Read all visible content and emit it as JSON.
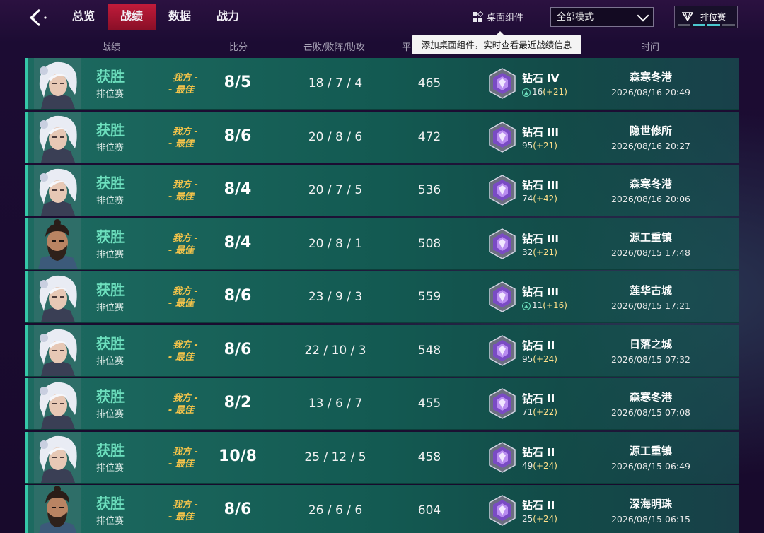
{
  "nav": {
    "tabs": [
      {
        "label": "总览",
        "active": false
      },
      {
        "label": "战绩",
        "active": true
      },
      {
        "label": "数据",
        "active": false
      },
      {
        "label": "战力",
        "active": false
      }
    ]
  },
  "toolbar": {
    "widget_label": "桌面组件",
    "tooltip": "添加桌面组件，实时查看最近战绩信息",
    "mode_select_value": "全部模式",
    "rank_mode_label": "排位赛"
  },
  "columns": {
    "record": "战绩",
    "score": "比分",
    "kda": "击败/败阵/助攻",
    "avg": "平",
    "time": "时间"
  },
  "matches": [
    {
      "hero": "white-hair",
      "result": "获胜",
      "type": "排位赛",
      "mvp1": "我方 -",
      "mvp2": "- 最佳",
      "score": "8/5",
      "kda": "18 / 7 / 4",
      "avg": "465",
      "tier": "钻石 IV",
      "pts": "16",
      "delta": "(+21)",
      "promo": true,
      "map": "森寒冬港",
      "time": "2026/08/16 20:49"
    },
    {
      "hero": "white-hair",
      "result": "获胜",
      "type": "排位赛",
      "mvp1": "我方 -",
      "mvp2": "- 最佳",
      "score": "8/6",
      "kda": "20 / 8 / 6",
      "avg": "472",
      "tier": "钻石 III",
      "pts": "95",
      "delta": "(+21)",
      "promo": false,
      "map": "隐世修所",
      "time": "2026/08/16 20:27"
    },
    {
      "hero": "white-hair",
      "result": "获胜",
      "type": "排位赛",
      "mvp1": "我方 -",
      "mvp2": "- 最佳",
      "score": "8/4",
      "kda": "20 / 7 / 5",
      "avg": "536",
      "tier": "钻石 III",
      "pts": "74",
      "delta": "(+42)",
      "promo": false,
      "map": "森寒冬港",
      "time": "2026/08/16 20:06"
    },
    {
      "hero": "bearded",
      "result": "获胜",
      "type": "排位赛",
      "mvp1": "我方 -",
      "mvp2": "- 最佳",
      "score": "8/4",
      "kda": "20 / 8 / 1",
      "avg": "508",
      "tier": "钻石 III",
      "pts": "32",
      "delta": "(+21)",
      "promo": false,
      "map": "源工重镇",
      "time": "2026/08/15 17:48"
    },
    {
      "hero": "white-hair",
      "result": "获胜",
      "type": "排位赛",
      "mvp1": "我方 -",
      "mvp2": "- 最佳",
      "score": "8/6",
      "kda": "23 / 9 / 3",
      "avg": "559",
      "tier": "钻石 III",
      "pts": "11",
      "delta": "(+16)",
      "promo": true,
      "map": "莲华古城",
      "time": "2026/08/15 17:21"
    },
    {
      "hero": "white-hair",
      "result": "获胜",
      "type": "排位赛",
      "mvp1": "我方 -",
      "mvp2": "- 最佳",
      "score": "8/6",
      "kda": "22 / 10 / 3",
      "avg": "548",
      "tier": "钻石 II",
      "pts": "95",
      "delta": "(+24)",
      "promo": false,
      "map": "日落之城",
      "time": "2026/08/15 07:32"
    },
    {
      "hero": "white-hair",
      "result": "获胜",
      "type": "排位赛",
      "mvp1": "我方 -",
      "mvp2": "- 最佳",
      "score": "8/2",
      "kda": "13 / 6 / 7",
      "avg": "455",
      "tier": "钻石 II",
      "pts": "71",
      "delta": "(+22)",
      "promo": false,
      "map": "森寒冬港",
      "time": "2026/08/15 07:08"
    },
    {
      "hero": "white-hair",
      "result": "获胜",
      "type": "排位赛",
      "mvp1": "我方 -",
      "mvp2": "- 最佳",
      "score": "10/8",
      "kda": "25 / 12 / 5",
      "avg": "458",
      "tier": "钻石 II",
      "pts": "49",
      "delta": "(+24)",
      "promo": false,
      "map": "源工重镇",
      "time": "2026/08/15 06:49"
    },
    {
      "hero": "bearded",
      "result": "获胜",
      "type": "排位赛",
      "mvp1": "我方 -",
      "mvp2": "- 最佳",
      "score": "8/6",
      "kda": "26 / 6 / 6",
      "avg": "604",
      "tier": "钻石 II",
      "pts": "25",
      "delta": "(+24)",
      "promo": false,
      "map": "深海明珠",
      "time": "2026/08/15 06:15"
    }
  ]
}
